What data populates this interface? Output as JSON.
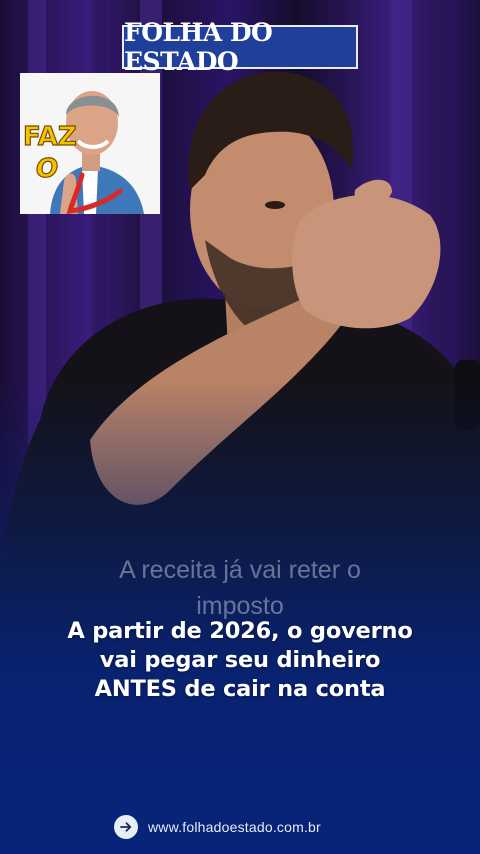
{
  "brand": {
    "logo_text": "FOLHA DO ESTADO",
    "color": "#1f3f9a"
  },
  "inset": {
    "sticker_text_1": "FAZ",
    "sticker_text_2": "O"
  },
  "video": {
    "subtitle_line1": "A receita já vai reter o",
    "subtitle_line2": "imposto"
  },
  "headline": {
    "line1": "A partir de 2026, o governo",
    "line2": "vai pegar seu dinheiro",
    "line3": "ANTES de cair na conta"
  },
  "footer": {
    "url": "www.folhadoestado.com.br",
    "icon": "arrow-right-icon"
  },
  "colors": {
    "overlay": "#08247a",
    "text": "#ffffff",
    "sticker": "#f2c400"
  }
}
